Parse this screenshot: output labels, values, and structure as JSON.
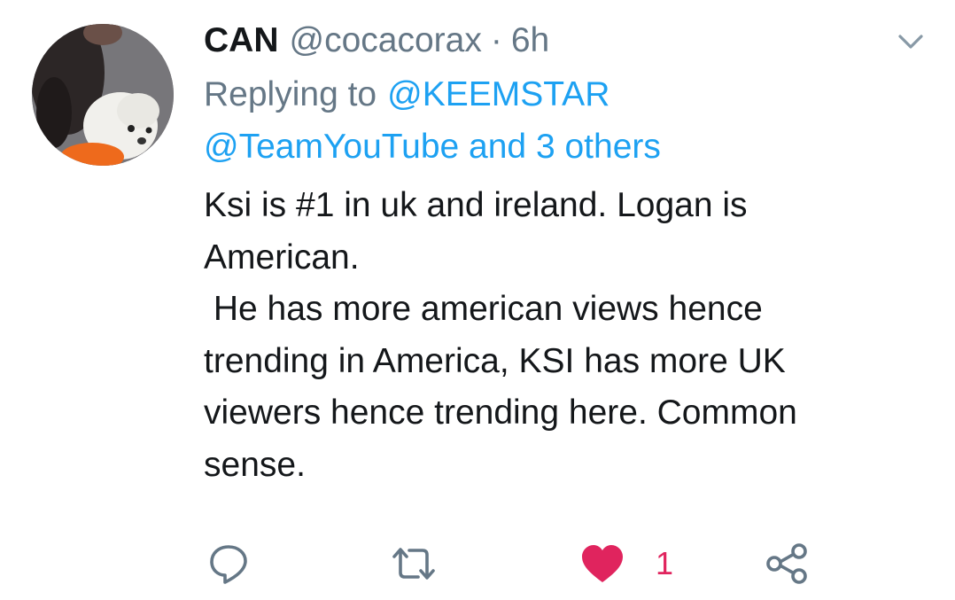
{
  "tweet": {
    "display_name": "CAN",
    "handle": "@cocacorax",
    "separator": "·",
    "time": "6h",
    "replying_prefix": "Replying to",
    "mention_primary": "@KEEMSTAR",
    "mention_secondary": "@TeamYouTube and 3 others",
    "text_lines": [
      "Ksi is #1 in uk and ireland. Logan is",
      "American.",
      " He has more american views hence",
      "trending in America, KSI has more UK",
      "viewers hence trending here. Common",
      "sense."
    ]
  },
  "actions": {
    "like_count": "1",
    "liked": true
  },
  "icons": {
    "menu": "chevron-down-icon",
    "reply": "reply-bubble-icon",
    "retweet": "retweet-icon",
    "like": "heart-icon",
    "share": "share-icon"
  },
  "colors": {
    "link": "#1da1f2",
    "secondary_text": "#657786",
    "like": "#e0245e",
    "icon": "#657786"
  }
}
